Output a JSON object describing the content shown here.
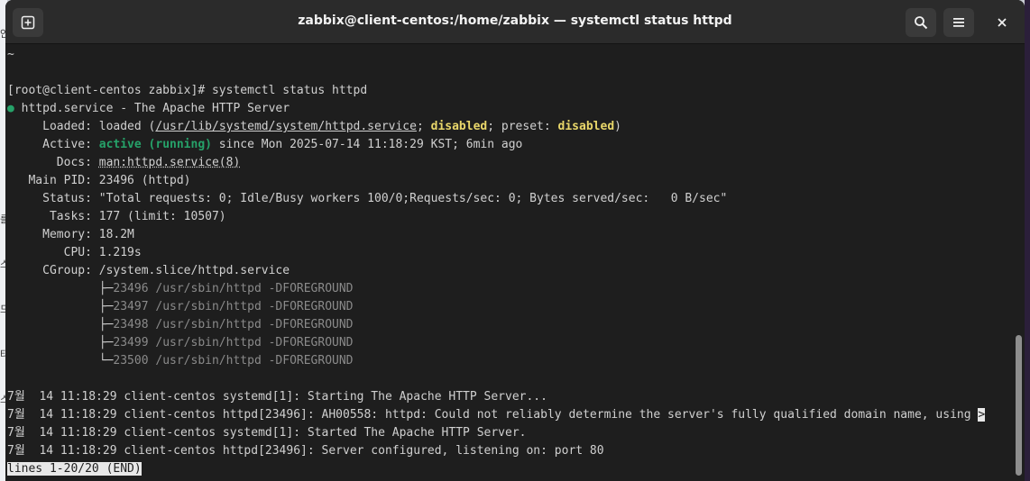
{
  "window": {
    "title": "zabbix@client-centos:/home/zabbix — systemctl status httpd"
  },
  "icons": {
    "new_tab": "new-tab-icon",
    "search": "search-icon",
    "menu": "hamburger-menu-icon",
    "close": "close-icon"
  },
  "terminal": {
    "line_tilde": "~",
    "line_prompt": "[root@client-centos zabbix]# systemctl status httpd",
    "service_bullet": "●",
    "service_name": " httpd.service - The Apache HTTP Server",
    "loaded": {
      "label": "     Loaded: loaded (",
      "path": "/usr/lib/systemd/system/httpd.service",
      "sep1": "; ",
      "state": "disabled",
      "sep2": "; preset: ",
      "preset": "disabled",
      "end": ")"
    },
    "active": {
      "label": "     Active: ",
      "state": "active (running)",
      "rest": " since Mon 2025-07-14 11:18:29 KST; 6min ago"
    },
    "docs": {
      "label": "       Docs: ",
      "value": "man:httpd.service(8)"
    },
    "main_pid": "   Main PID: 23496 (httpd)",
    "status": "     Status: \"Total requests: 0; Idle/Busy workers 100/0;Requests/sec: 0; Bytes served/sec:   0 B/sec\"",
    "tasks": "      Tasks: 177 (limit: 10507)",
    "memory": "     Memory: 18.2M",
    "cpu": "        CPU: 1.219s",
    "cgroup": "     CGroup: /system.slice/httpd.service",
    "processes": [
      {
        "tree": "             ├─",
        "cmd": "23496 /usr/sbin/httpd -DFOREGROUND"
      },
      {
        "tree": "             ├─",
        "cmd": "23497 /usr/sbin/httpd -DFOREGROUND"
      },
      {
        "tree": "             ├─",
        "cmd": "23498 /usr/sbin/httpd -DFOREGROUND"
      },
      {
        "tree": "             ├─",
        "cmd": "23499 /usr/sbin/httpd -DFOREGROUND"
      },
      {
        "tree": "             └─",
        "cmd": "23500 /usr/sbin/httpd -DFOREGROUND"
      }
    ],
    "logs": [
      "7월  14 11:18:29 client-centos systemd[1]: Starting The Apache HTTP Server...",
      "7월  14 11:18:29 client-centos httpd[23496]: AH00558: httpd: Could not reliably determine the server's fully qualified domain name, using ",
      "7월  14 11:18:29 client-centos systemd[1]: Started The Apache HTTP Server.",
      "7월  14 11:18:29 client-centos httpd[23496]: Server configured, listening on: port 80"
    ],
    "truncation_marker": ">",
    "pager_status": "lines 1-20/20 (END)"
  },
  "desktop_glyphs": [
    "안",
    "를",
    "스",
    "드",
    "타",
    "스"
  ]
}
